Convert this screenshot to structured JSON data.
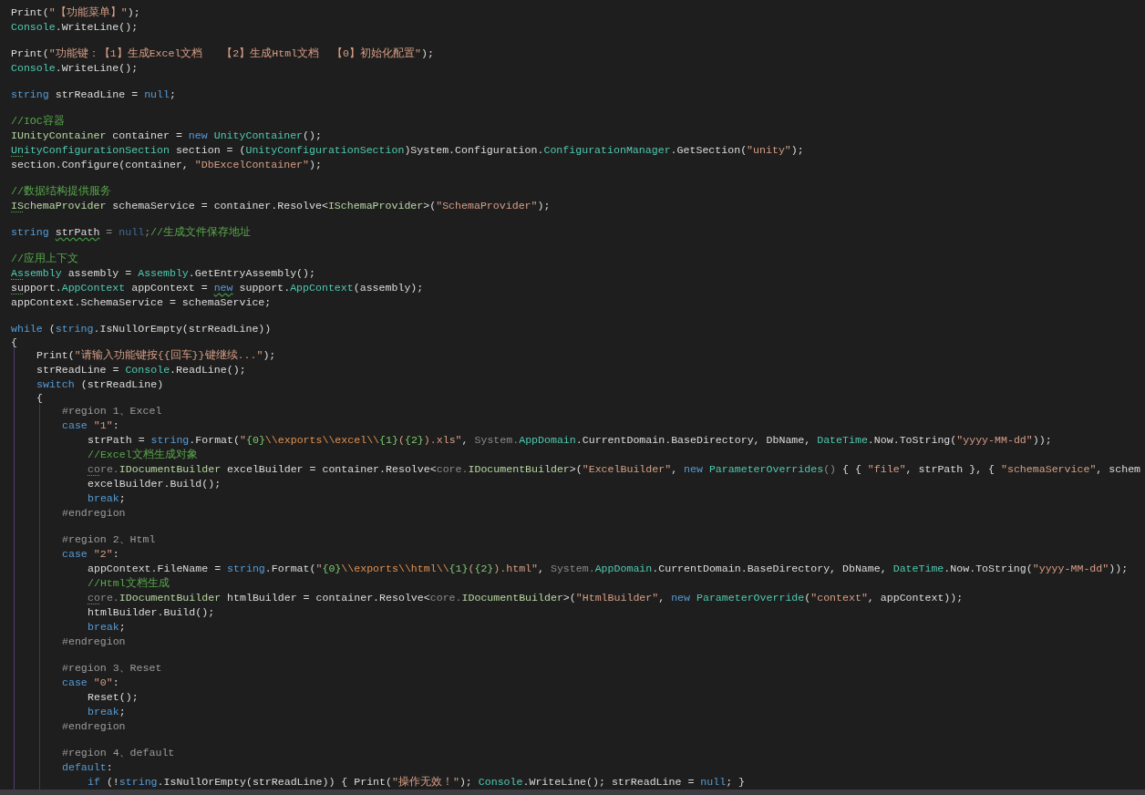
{
  "editor": {
    "lines": [
      {
        "kind": "code",
        "tokens": [
          {
            "text": "Print(",
            "kind": "plain"
          },
          {
            "text": "\"【功能菜单】\"",
            "kind": "string"
          },
          {
            "text": ");",
            "kind": "plain"
          }
        ]
      },
      {
        "kind": "code",
        "tokens": [
          {
            "text": "Console",
            "kind": "type"
          },
          {
            "text": ".WriteLine();",
            "kind": "plain"
          }
        ]
      },
      {
        "kind": "blank"
      },
      {
        "kind": "code",
        "tokens": [
          {
            "text": "Print(",
            "kind": "plain"
          },
          {
            "text": "\"功能键：【1】生成Excel文档   【2】生成Html文档  【0】初始化配置\"",
            "kind": "string"
          },
          {
            "text": ");",
            "kind": "plain"
          }
        ]
      },
      {
        "kind": "code",
        "tokens": [
          {
            "text": "Console",
            "kind": "type"
          },
          {
            "text": ".WriteLine();",
            "kind": "plain"
          }
        ]
      },
      {
        "kind": "blank"
      },
      {
        "kind": "code",
        "tokens": [
          {
            "text": "string",
            "kind": "keyword"
          },
          {
            "text": " strReadLine = ",
            "kind": "plain"
          },
          {
            "text": "null",
            "kind": "keyword"
          },
          {
            "text": ";",
            "kind": "plain"
          }
        ]
      },
      {
        "kind": "blank"
      },
      {
        "kind": "code",
        "tokens": [
          {
            "text": "//IOC容器",
            "kind": "comment"
          }
        ]
      },
      {
        "kind": "code",
        "tokens": [
          {
            "text": "IUnityContainer",
            "kind": "interface"
          },
          {
            "text": " container = ",
            "kind": "plain"
          },
          {
            "text": "new ",
            "kind": "keyword"
          },
          {
            "text": "UnityContainer",
            "kind": "type"
          },
          {
            "text": "();",
            "kind": "plain"
          }
        ]
      },
      {
        "kind": "code",
        "tokens": [
          {
            "text": "Un",
            "kind": "type-suggested"
          },
          {
            "text": "ityConfigurationSection",
            "kind": "type"
          },
          {
            "text": " section = (",
            "kind": "plain"
          },
          {
            "text": "UnityConfigurationSection",
            "kind": "type"
          },
          {
            "text": ")System.Configuration.",
            "kind": "plain"
          },
          {
            "text": "ConfigurationManager",
            "kind": "type"
          },
          {
            "text": ".GetSection(",
            "kind": "plain"
          },
          {
            "text": "\"unity\"",
            "kind": "string"
          },
          {
            "text": ");",
            "kind": "plain"
          }
        ]
      },
      {
        "kind": "code",
        "tokens": [
          {
            "text": "section.Configure(container, ",
            "kind": "plain"
          },
          {
            "text": "\"DbExcelContainer\"",
            "kind": "string"
          },
          {
            "text": ");",
            "kind": "plain"
          }
        ]
      },
      {
        "kind": "blank"
      },
      {
        "kind": "code",
        "tokens": [
          {
            "text": "//数据结构提供服务",
            "kind": "comment"
          }
        ]
      },
      {
        "kind": "code",
        "tokens": [
          {
            "text": "IS",
            "kind": "interface-suggested"
          },
          {
            "text": "chemaProvider",
            "kind": "interface"
          },
          {
            "text": " schemaService = container.Resolve<",
            "kind": "plain"
          },
          {
            "text": "ISchemaProvider",
            "kind": "interface"
          },
          {
            "text": ">(",
            "kind": "plain"
          },
          {
            "text": "\"SchemaProvider\"",
            "kind": "string"
          },
          {
            "text": ");",
            "kind": "plain"
          }
        ]
      },
      {
        "kind": "blank"
      },
      {
        "kind": "code",
        "tokens": [
          {
            "text": "string ",
            "kind": "keyword"
          },
          {
            "text": "strPath",
            "kind": "plain-warned"
          },
          {
            "text": " = ",
            "kind": "faded"
          },
          {
            "text": "null",
            "kind": "faded-keyword"
          },
          {
            "text": ";",
            "kind": "faded"
          },
          {
            "text": "//生成文件保存地址",
            "kind": "comment"
          }
        ]
      },
      {
        "kind": "blank"
      },
      {
        "kind": "code",
        "tokens": [
          {
            "text": "//应用上下文",
            "kind": "comment"
          }
        ]
      },
      {
        "kind": "code",
        "tokens": [
          {
            "text": "As",
            "kind": "type-suggested"
          },
          {
            "text": "sembly",
            "kind": "type"
          },
          {
            "text": " assembly = ",
            "kind": "plain"
          },
          {
            "text": "Assembly",
            "kind": "type"
          },
          {
            "text": ".GetEntryAssembly();",
            "kind": "plain"
          }
        ]
      },
      {
        "kind": "code",
        "tokens": [
          {
            "text": "su",
            "kind": "plain-suggested"
          },
          {
            "text": "pport.",
            "kind": "plain"
          },
          {
            "text": "AppContext",
            "kind": "type"
          },
          {
            "text": " appContext = ",
            "kind": "plain"
          },
          {
            "text": "new",
            "kind": "keyword-warned"
          },
          {
            "text": " support.",
            "kind": "plain"
          },
          {
            "text": "AppContext",
            "kind": "type"
          },
          {
            "text": "(assembly);",
            "kind": "plain"
          }
        ]
      },
      {
        "kind": "code",
        "tokens": [
          {
            "text": "appContext.SchemaService = schemaService;",
            "kind": "plain"
          }
        ]
      },
      {
        "kind": "blank"
      },
      {
        "kind": "code",
        "tokens": [
          {
            "text": "while",
            "kind": "keyword"
          },
          {
            "text": " (",
            "kind": "plain"
          },
          {
            "text": "string",
            "kind": "keyword"
          },
          {
            "text": ".IsNullOrEmpty(strReadLine))",
            "kind": "plain"
          }
        ]
      },
      {
        "kind": "brace",
        "tokens": [
          {
            "text": "{",
            "kind": "plain"
          }
        ],
        "guide": true,
        "children": [
          {
            "kind": "code",
            "tokens": [
              {
                "text": "Print(",
                "kind": "plain"
              },
              {
                "text": "\"请输入功能键按{{回车}}键继续...\"",
                "kind": "string"
              },
              {
                "text": ");",
                "kind": "plain"
              }
            ]
          },
          {
            "kind": "code",
            "tokens": [
              {
                "text": "strReadLine = ",
                "kind": "plain"
              },
              {
                "text": "Console",
                "kind": "type"
              },
              {
                "text": ".ReadLine();",
                "kind": "plain"
              }
            ]
          },
          {
            "kind": "code",
            "tokens": [
              {
                "text": "switch",
                "kind": "keyword"
              },
              {
                "text": " (strReadLine)",
                "kind": "plain"
              }
            ]
          },
          {
            "kind": "brace",
            "tokens": [
              {
                "text": "{",
                "kind": "plain"
              }
            ],
            "guide": true,
            "children": [
              {
                "kind": "code",
                "tokens": [
                  {
                    "text": "#region 1、Excel",
                    "kind": "preproc"
                  }
                ]
              },
              {
                "kind": "code",
                "tokens": [
                  {
                    "text": "case ",
                    "kind": "keyword"
                  },
                  {
                    "text": "\"1\"",
                    "kind": "string"
                  },
                  {
                    "text": ":",
                    "kind": "plain"
                  }
                ],
                "guide": false,
                "children": [
                  {
                    "kind": "code",
                    "tokens": [
                      {
                        "text": "strPath = ",
                        "kind": "plain"
                      },
                      {
                        "text": "string",
                        "kind": "keyword"
                      },
                      {
                        "text": ".Format(",
                        "kind": "plain"
                      },
                      {
                        "text": "\"",
                        "kind": "string"
                      },
                      {
                        "text": "{0}",
                        "kind": "format"
                      },
                      {
                        "text": "\\\\exports\\\\excel\\\\",
                        "kind": "escape"
                      },
                      {
                        "text": "{1}",
                        "kind": "format"
                      },
                      {
                        "text": "(",
                        "kind": "string"
                      },
                      {
                        "text": "{2}",
                        "kind": "format"
                      },
                      {
                        "text": ").xls\"",
                        "kind": "string"
                      },
                      {
                        "text": ", ",
                        "kind": "plain"
                      },
                      {
                        "text": "System.",
                        "kind": "faded"
                      },
                      {
                        "text": "AppDomain",
                        "kind": "type"
                      },
                      {
                        "text": ".CurrentDomain.BaseDirectory, DbName, ",
                        "kind": "plain"
                      },
                      {
                        "text": "DateTime",
                        "kind": "type"
                      },
                      {
                        "text": ".Now.ToString(",
                        "kind": "plain"
                      },
                      {
                        "text": "\"yyyy-MM-dd\"",
                        "kind": "string"
                      },
                      {
                        "text": "));",
                        "kind": "plain"
                      }
                    ]
                  },
                  {
                    "kind": "code",
                    "tokens": [
                      {
                        "text": "//Excel文档生成对象",
                        "kind": "comment"
                      }
                    ]
                  },
                  {
                    "kind": "code",
                    "tokens": [
                      {
                        "text": "co",
                        "kind": "faded-suggested"
                      },
                      {
                        "text": "re.",
                        "kind": "faded"
                      },
                      {
                        "text": "IDocumentBuilder",
                        "kind": "interface"
                      },
                      {
                        "text": " excelBuilder = container.Resolve<",
                        "kind": "plain"
                      },
                      {
                        "text": "core.",
                        "kind": "faded"
                      },
                      {
                        "text": "IDocumentBuilder",
                        "kind": "interface"
                      },
                      {
                        "text": ">(",
                        "kind": "plain"
                      },
                      {
                        "text": "\"ExcelBuilder\"",
                        "kind": "string"
                      },
                      {
                        "text": ", ",
                        "kind": "plain"
                      },
                      {
                        "text": "new ",
                        "kind": "keyword"
                      },
                      {
                        "text": "ParameterOverrides",
                        "kind": "type"
                      },
                      {
                        "text": "()",
                        "kind": "faded"
                      },
                      {
                        "text": " { { ",
                        "kind": "plain"
                      },
                      {
                        "text": "\"file\"",
                        "kind": "string"
                      },
                      {
                        "text": ", strPath }, { ",
                        "kind": "plain"
                      },
                      {
                        "text": "\"schemaService\"",
                        "kind": "string"
                      },
                      {
                        "text": ", schem",
                        "kind": "plain"
                      }
                    ]
                  },
                  {
                    "kind": "code",
                    "tokens": [
                      {
                        "text": "excelBuilder.Build();",
                        "kind": "plain"
                      }
                    ]
                  },
                  {
                    "kind": "code",
                    "tokens": [
                      {
                        "text": "break",
                        "kind": "keyword"
                      },
                      {
                        "text": ";",
                        "kind": "plain"
                      }
                    ]
                  }
                ]
              },
              {
                "kind": "code",
                "tokens": [
                  {
                    "text": "#endregion",
                    "kind": "preproc"
                  }
                ]
              },
              {
                "kind": "blank"
              },
              {
                "kind": "code",
                "tokens": [
                  {
                    "text": "#region 2、Html",
                    "kind": "preproc"
                  }
                ]
              },
              {
                "kind": "code",
                "tokens": [
                  {
                    "text": "case ",
                    "kind": "keyword"
                  },
                  {
                    "text": "\"2\"",
                    "kind": "string"
                  },
                  {
                    "text": ":",
                    "kind": "plain"
                  }
                ],
                "guide": false,
                "children": [
                  {
                    "kind": "code",
                    "tokens": [
                      {
                        "text": "appContext.FileName = ",
                        "kind": "plain"
                      },
                      {
                        "text": "string",
                        "kind": "keyword"
                      },
                      {
                        "text": ".Format(",
                        "kind": "plain"
                      },
                      {
                        "text": "\"",
                        "kind": "string"
                      },
                      {
                        "text": "{0}",
                        "kind": "format"
                      },
                      {
                        "text": "\\\\exports\\\\html\\\\",
                        "kind": "escape"
                      },
                      {
                        "text": "{1}",
                        "kind": "format"
                      },
                      {
                        "text": "(",
                        "kind": "string"
                      },
                      {
                        "text": "{2}",
                        "kind": "format"
                      },
                      {
                        "text": ").html\"",
                        "kind": "string"
                      },
                      {
                        "text": ", ",
                        "kind": "plain"
                      },
                      {
                        "text": "System.",
                        "kind": "faded"
                      },
                      {
                        "text": "AppDomain",
                        "kind": "type"
                      },
                      {
                        "text": ".CurrentDomain.BaseDirectory, DbName, ",
                        "kind": "plain"
                      },
                      {
                        "text": "DateTime",
                        "kind": "type"
                      },
                      {
                        "text": ".Now.ToString(",
                        "kind": "plain"
                      },
                      {
                        "text": "\"yyyy-MM-dd\"",
                        "kind": "string"
                      },
                      {
                        "text": "));",
                        "kind": "plain"
                      }
                    ]
                  },
                  {
                    "kind": "code",
                    "tokens": [
                      {
                        "text": "//Html文档生成",
                        "kind": "comment"
                      }
                    ]
                  },
                  {
                    "kind": "code",
                    "tokens": [
                      {
                        "text": "co",
                        "kind": "faded-suggested"
                      },
                      {
                        "text": "re.",
                        "kind": "faded"
                      },
                      {
                        "text": "IDocumentBuilder",
                        "kind": "interface"
                      },
                      {
                        "text": " htmlBuilder = container.Resolve<",
                        "kind": "plain"
                      },
                      {
                        "text": "core.",
                        "kind": "faded"
                      },
                      {
                        "text": "IDocumentBuilder",
                        "kind": "interface"
                      },
                      {
                        "text": ">(",
                        "kind": "plain"
                      },
                      {
                        "text": "\"HtmlBuilder\"",
                        "kind": "string"
                      },
                      {
                        "text": ", ",
                        "kind": "plain"
                      },
                      {
                        "text": "new ",
                        "kind": "keyword"
                      },
                      {
                        "text": "ParameterOverride",
                        "kind": "type"
                      },
                      {
                        "text": "(",
                        "kind": "plain"
                      },
                      {
                        "text": "\"context\"",
                        "kind": "string"
                      },
                      {
                        "text": ", appContext));",
                        "kind": "plain"
                      }
                    ]
                  },
                  {
                    "kind": "code",
                    "tokens": [
                      {
                        "text": "htmlBuilder.Build();",
                        "kind": "plain"
                      }
                    ]
                  },
                  {
                    "kind": "code",
                    "tokens": [
                      {
                        "text": "break",
                        "kind": "keyword"
                      },
                      {
                        "text": ";",
                        "kind": "plain"
                      }
                    ]
                  }
                ]
              },
              {
                "kind": "code",
                "tokens": [
                  {
                    "text": "#endregion",
                    "kind": "preproc"
                  }
                ]
              },
              {
                "kind": "blank"
              },
              {
                "kind": "code",
                "tokens": [
                  {
                    "text": "#region 3、Reset",
                    "kind": "preproc"
                  }
                ]
              },
              {
                "kind": "code",
                "tokens": [
                  {
                    "text": "case ",
                    "kind": "keyword"
                  },
                  {
                    "text": "\"0\"",
                    "kind": "string"
                  },
                  {
                    "text": ":",
                    "kind": "plain"
                  }
                ],
                "guide": false,
                "children": [
                  {
                    "kind": "code",
                    "tokens": [
                      {
                        "text": "Reset();",
                        "kind": "plain"
                      }
                    ]
                  },
                  {
                    "kind": "code",
                    "tokens": [
                      {
                        "text": "break",
                        "kind": "keyword"
                      },
                      {
                        "text": ";",
                        "kind": "plain"
                      }
                    ]
                  }
                ]
              },
              {
                "kind": "code",
                "tokens": [
                  {
                    "text": "#endregion",
                    "kind": "preproc"
                  }
                ]
              },
              {
                "kind": "blank"
              },
              {
                "kind": "code",
                "tokens": [
                  {
                    "text": "#region 4、default",
                    "kind": "preproc"
                  }
                ]
              },
              {
                "kind": "code",
                "tokens": [
                  {
                    "text": "default",
                    "kind": "keyword"
                  },
                  {
                    "text": ":",
                    "kind": "plain"
                  }
                ],
                "guide": false,
                "children": [
                  {
                    "kind": "code",
                    "tokens": [
                      {
                        "text": "if",
                        "kind": "keyword"
                      },
                      {
                        "text": " (!",
                        "kind": "plain"
                      },
                      {
                        "text": "string",
                        "kind": "keyword"
                      },
                      {
                        "text": ".IsNullOrEmpty(strReadLine)) { Print(",
                        "kind": "plain"
                      },
                      {
                        "text": "\"操作无效！\"",
                        "kind": "string"
                      },
                      {
                        "text": "); ",
                        "kind": "plain"
                      },
                      {
                        "text": "Console",
                        "kind": "type"
                      },
                      {
                        "text": ".WriteLine(); strReadLine = ",
                        "kind": "plain"
                      },
                      {
                        "text": "null",
                        "kind": "keyword"
                      },
                      {
                        "text": "; }",
                        "kind": "plain"
                      }
                    ]
                  }
                ]
              }
            ]
          }
        ]
      }
    ]
  }
}
